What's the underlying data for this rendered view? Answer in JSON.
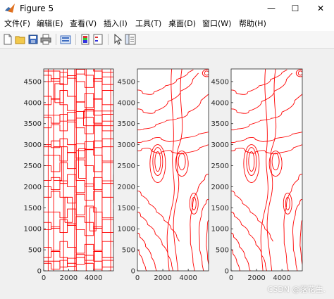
{
  "window": {
    "title": "Figure 5",
    "controls": {
      "minimize": "—",
      "maximize": "☐",
      "close": "✕"
    }
  },
  "menu": [
    {
      "label": "文件(F)"
    },
    {
      "label": "编辑(E)"
    },
    {
      "label": "查看(V)"
    },
    {
      "label": "插入(I)"
    },
    {
      "label": "工具(T)"
    },
    {
      "label": "桌面(D)"
    },
    {
      "label": "窗口(W)"
    },
    {
      "label": "帮助(H)"
    }
  ],
  "toolbar": {
    "icons": [
      "new-figure-icon",
      "open-file-icon",
      "save-icon",
      "print-icon",
      "link-plot-icon",
      "colorbar-icon",
      "legend-icon",
      "edit-plot-arrow-icon",
      "property-inspector-icon"
    ]
  },
  "watermark": "CSDN @落花生.",
  "colors": {
    "contour": "#ff0000",
    "axes_bg": "#ffffff",
    "figure_bg": "#f0f0f0"
  },
  "chart_data": [
    {
      "type": "contour",
      "x_ticks": [
        "0",
        "2000",
        "4000"
      ],
      "y_ticks": [
        "0",
        "500",
        "1000",
        "1500",
        "2000",
        "2500",
        "3000",
        "3500",
        "4000",
        "4500"
      ],
      "xlim": [
        0,
        5600
      ],
      "ylim": [
        0,
        4800
      ],
      "style": "blocky"
    },
    {
      "type": "contour",
      "x_ticks": [
        "0",
        "2000",
        "4000"
      ],
      "y_ticks": [
        "0",
        "500",
        "1000",
        "1500",
        "2000",
        "2500",
        "3000",
        "3500",
        "4000",
        "4500"
      ],
      "xlim": [
        0,
        5600
      ],
      "ylim": [
        0,
        4800
      ],
      "style": "smooth"
    },
    {
      "type": "contour",
      "x_ticks": [
        "0",
        "2000",
        "4000"
      ],
      "y_ticks": [
        "0",
        "500",
        "1000",
        "1500",
        "2000",
        "2500",
        "3000",
        "3500",
        "4000",
        "4500"
      ],
      "xlim": [
        0,
        5600
      ],
      "ylim": [
        0,
        4800
      ],
      "style": "smooth"
    }
  ]
}
